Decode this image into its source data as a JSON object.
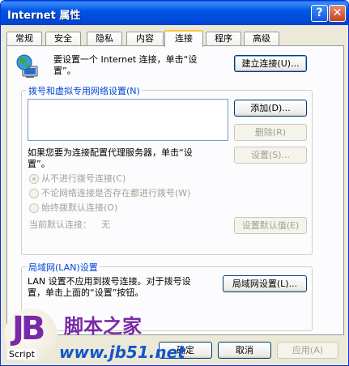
{
  "window": {
    "title": "Internet 属性",
    "help_glyph": "?",
    "close_glyph": "✕"
  },
  "tabs": [
    {
      "label": "常规"
    },
    {
      "label": "安全"
    },
    {
      "label": "隐私"
    },
    {
      "label": "内容"
    },
    {
      "label": "连接"
    },
    {
      "label": "程序"
    },
    {
      "label": "高级"
    }
  ],
  "active_tab": "连接",
  "setup": {
    "text_line1": "要设置一个 Internet 连接，单击“设",
    "text_line2": "置”。",
    "button": "建立连接(U)..."
  },
  "dialup": {
    "legend": "拨号和虚拟专用网络设置(N)",
    "add_button": "添加(D)...",
    "delete_button": "删除(R)",
    "settings_button": "设置(S)...",
    "proxy_text_line1": "如果您要为连接配置代理服务器，单击“设",
    "proxy_text_line2": "置”。",
    "radio_never": "从不进行拨号连接(C)",
    "radio_no_network": "不论网络连接是否存在都进行拨号(W)",
    "radio_always": "始终拨默认连接(O)",
    "default_label": "当前默认连接：",
    "default_value": "无",
    "set_default_button": "设置默认值(E)"
  },
  "lan": {
    "legend": "局域网(LAN)设置",
    "text_line1": "LAN 设置不应用到拨号连接。对于拨号设",
    "text_line2": "置，单击上面的“设置”按钮。",
    "button": "局域网设置(L)..."
  },
  "footer": {
    "ok": "确定",
    "cancel": "取消",
    "apply": "应用(A)"
  },
  "watermark": {
    "logo_letters": "JB",
    "script_label": "Script",
    "site_cn": "脚本之家",
    "site_url": "www.jb51.net"
  },
  "colors": {
    "titlebar": "#0055e5",
    "accent_legend": "#0046d5",
    "tab_highlight": "#ffc83c",
    "watermark_purple": "#7a2aa8",
    "watermark_blue": "#1456c8"
  }
}
